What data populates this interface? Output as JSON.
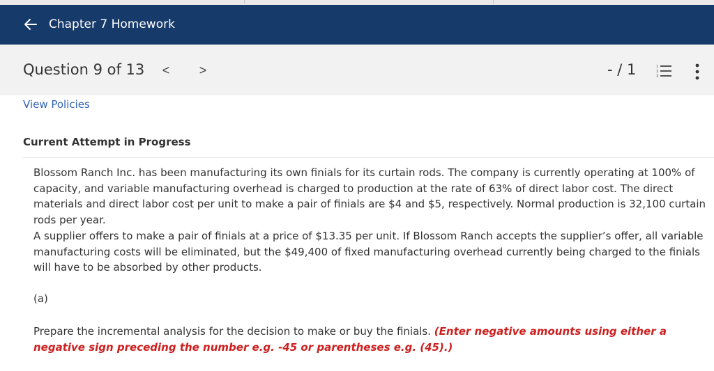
{
  "header": {
    "back_icon": "arrow-left-icon",
    "title": "Chapter 7 Homework"
  },
  "question_bar": {
    "label": "Question 9 of 13",
    "prev_icon": "chevron-left-icon",
    "next_icon": "chevron-right-icon",
    "prev_glyph": "<",
    "next_glyph": ">",
    "score": "- / 1",
    "list_icon": "numbered-list-icon",
    "more_icon": "vertical-ellipsis-icon"
  },
  "content": {
    "policies_link": "View Policies",
    "attempt_heading": "Current Attempt in Progress",
    "paragraph1": "Blossom Ranch Inc. has been manufacturing its own finials for its curtain rods. The company is currently operating at 100% of capacity, and variable manufacturing overhead is charged to production at the rate of 63% of direct labor cost. The direct materials and direct labor cost per unit to make a pair of finials are $4 and $5, respectively. Normal production is 32,100 curtain rods per year.",
    "paragraph2": "A supplier offers to make a pair of finials at a price of $13.35 per unit. If Blossom Ranch accepts the supplier’s offer, all variable manufacturing costs will be eliminated, but the $49,400 of fixed manufacturing overhead currently being charged to the finials will have to be absorbed by other products.",
    "part_label": "(a)",
    "instruction": "Prepare the incremental analysis for the decision to make or buy the finials.",
    "instruction_note": "(Enter negative amounts using either a negative sign preceding the number e.g. -45 or parentheses e.g. (45).)"
  },
  "colors": {
    "header_bg": "#163a6a",
    "link": "#2f62b5",
    "note_red": "#cc1f1f"
  }
}
